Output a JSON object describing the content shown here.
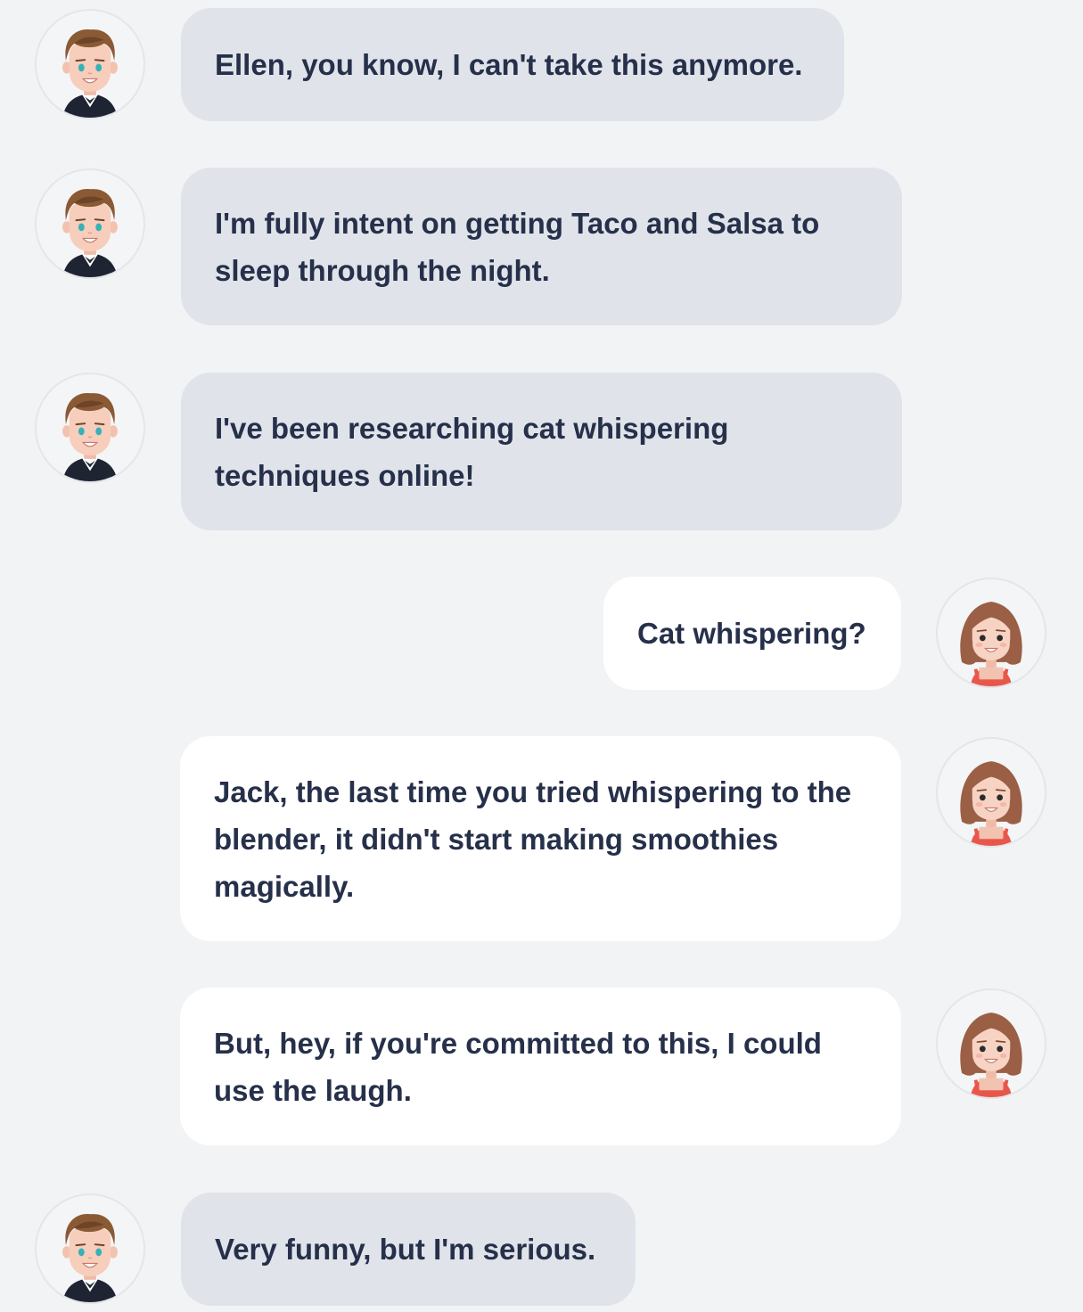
{
  "participants": {
    "jack": {
      "name": "Jack",
      "avatar_icon": "boy-avatar-icon",
      "bubble_color": "#e0e4ea"
    },
    "ellen": {
      "name": "Ellen",
      "avatar_icon": "girl-avatar-icon",
      "bubble_color": "#ffffff"
    }
  },
  "messages": [
    {
      "sender": "jack",
      "text": "Ellen, you know, I can't take this anymore."
    },
    {
      "sender": "jack",
      "text": "I'm fully intent on getting Taco and Salsa to sleep through the night."
    },
    {
      "sender": "jack",
      "text": "I've been researching cat whispering techniques online!"
    },
    {
      "sender": "ellen",
      "text": "Cat whispering?"
    },
    {
      "sender": "ellen",
      "text": "Jack, the last time you tried whispering to the blender, it didn't start making smoothies magically."
    },
    {
      "sender": "ellen",
      "text": "But, hey, if you're committed to this, I could use the laugh."
    },
    {
      "sender": "jack",
      "text": "Very funny, but I'm serious."
    }
  ],
  "colors": {
    "background": "#f2f3f5",
    "text": "#26304a"
  }
}
